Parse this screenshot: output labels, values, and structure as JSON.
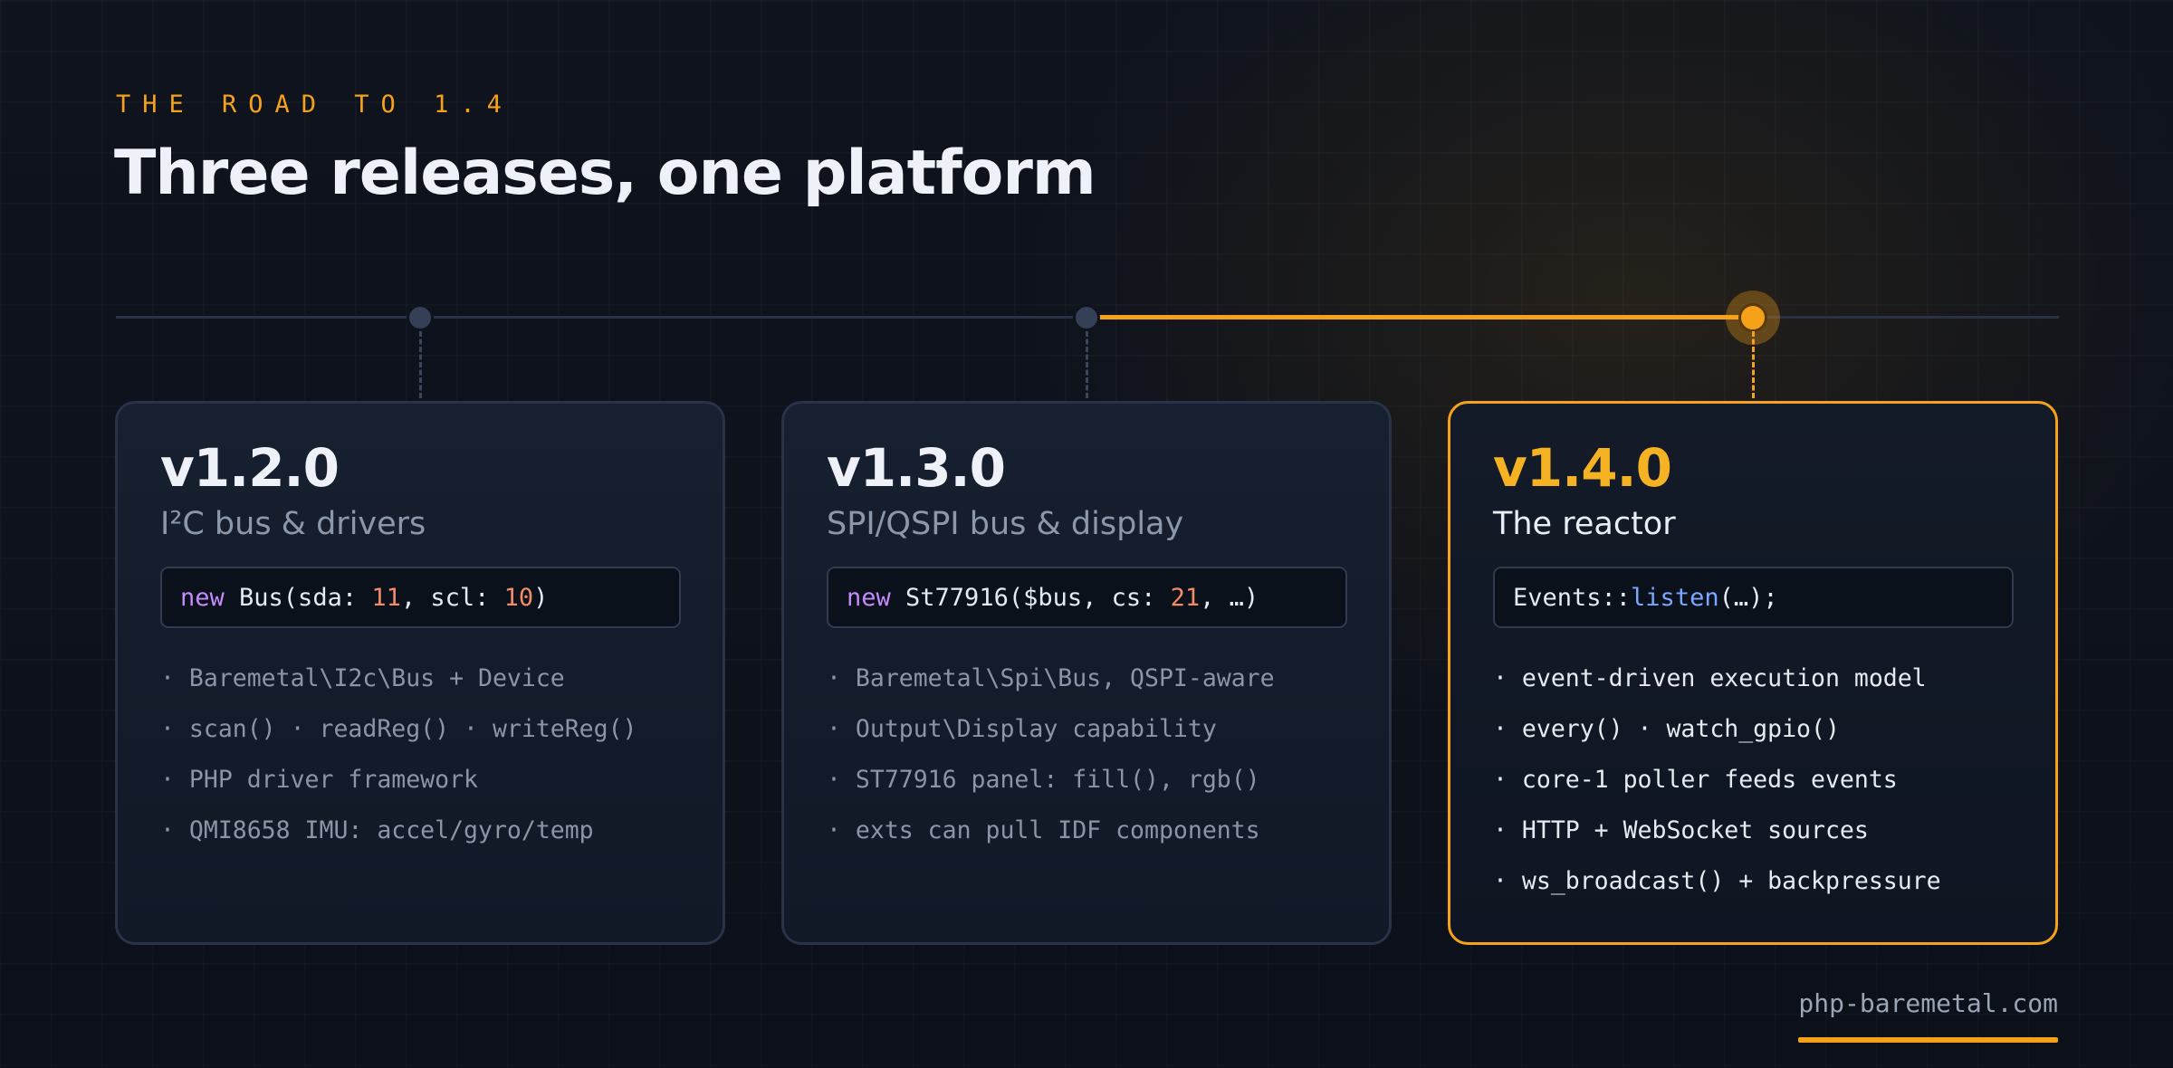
{
  "eyebrow": "THE ROAD TO 1.4",
  "title": "Three releases, one platform",
  "accent_color": "#f5a21a",
  "releases": [
    {
      "version": "v1.2.0",
      "subtitle": "I²C bus & drivers",
      "active": false,
      "code": [
        {
          "t": "new",
          "k": "kw"
        },
        {
          "t": " Bus(sda: ",
          "k": ""
        },
        {
          "t": "11",
          "k": "num"
        },
        {
          "t": ", scl: ",
          "k": ""
        },
        {
          "t": "10",
          "k": "num"
        },
        {
          "t": ")",
          "k": ""
        }
      ],
      "bullets": [
        "· Baremetal\\I2c\\Bus + Device",
        "· scan() · readReg() · writeReg()",
        "· PHP driver framework",
        "· QMI8658 IMU: accel/gyro/temp"
      ]
    },
    {
      "version": "v1.3.0",
      "subtitle": "SPI/QSPI bus & display",
      "active": false,
      "code": [
        {
          "t": "new",
          "k": "kw"
        },
        {
          "t": " St77916($bus, cs: ",
          "k": ""
        },
        {
          "t": "21",
          "k": "num"
        },
        {
          "t": ", …)",
          "k": ""
        }
      ],
      "bullets": [
        "· Baremetal\\Spi\\Bus, QSPI-aware",
        "· Output\\Display capability",
        "· ST77916 panel: fill(), rgb()",
        "· exts can pull IDF components"
      ]
    },
    {
      "version": "v1.4.0",
      "subtitle": "The reactor",
      "active": true,
      "code": [
        {
          "t": "Events::",
          "k": ""
        },
        {
          "t": "listen",
          "k": "fn"
        },
        {
          "t": "(…);",
          "k": ""
        }
      ],
      "bullets": [
        "· event-driven execution model",
        "· every() · watch_gpio()",
        "· core-1 poller feeds events",
        "· HTTP + WebSocket sources",
        "· ws_broadcast() + backpressure"
      ]
    }
  ],
  "footer": {
    "site": "php-baremetal.com"
  }
}
